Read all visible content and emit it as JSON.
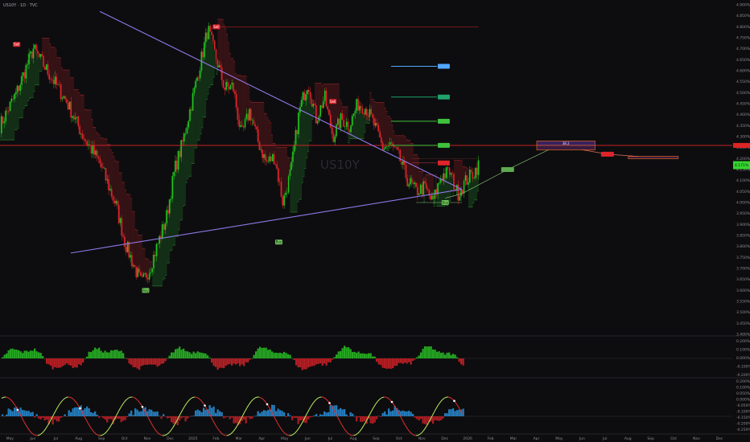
{
  "header": {
    "symbol": "US10Y · 1D · TVC"
  },
  "watermark": "US10Y",
  "colors": {
    "up": "#22c51d",
    "down": "#e0242b",
    "trend": "#9077e8",
    "resistance": "#e02424",
    "bg": "#0d0d0f"
  },
  "chart_data": {
    "type": "candlestick",
    "yticks": [
      "4.900%",
      "4.850%",
      "4.800%",
      "4.750%",
      "4.700%",
      "4.650%",
      "4.600%",
      "4.550%",
      "4.500%",
      "4.450%",
      "4.400%",
      "4.350%",
      "4.300%",
      "4.250%",
      "4.200%",
      "4.150%",
      "4.100%",
      "4.050%",
      "4.000%",
      "3.950%",
      "3.900%",
      "3.850%",
      "3.800%",
      "3.750%",
      "3.700%",
      "3.650%",
      "3.600%",
      "3.550%",
      "3.500%",
      "3.450%",
      "3.400%"
    ],
    "ylim": [
      3.4,
      4.9
    ],
    "xticks": [
      "May",
      "Jun",
      "Jul",
      "Aug",
      "Sep",
      "Oct",
      "Nov",
      "Dec",
      "2025",
      "Feb",
      "Mar",
      "Apr",
      "May",
      "Jun",
      "Jul",
      "Aug",
      "Sep",
      "Oct",
      "Nov",
      "Dec",
      "2026",
      "Feb",
      "Mar",
      "Apr",
      "May",
      "Jun",
      "Jul",
      "Aug",
      "Sep",
      "Oct",
      "Nov",
      "Dec"
    ],
    "price_path": [
      [
        0,
        4.35
      ],
      [
        2,
        4.5
      ],
      [
        4,
        4.7
      ],
      [
        6,
        4.58
      ],
      [
        8,
        4.46
      ],
      [
        10,
        4.3
      ],
      [
        12,
        4.18
      ],
      [
        14,
        3.98
      ],
      [
        15,
        3.82
      ],
      [
        16,
        3.72
      ],
      [
        17,
        3.63
      ],
      [
        18,
        3.7
      ],
      [
        20,
        3.93
      ],
      [
        21,
        4.15
      ],
      [
        22,
        4.28
      ],
      [
        23,
        4.45
      ],
      [
        24,
        4.62
      ],
      [
        25,
        4.79
      ],
      [
        26,
        4.65
      ],
      [
        27,
        4.52
      ],
      [
        28,
        4.53
      ],
      [
        29,
        4.3
      ],
      [
        30,
        4.42
      ],
      [
        31,
        4.28
      ],
      [
        32,
        4.18
      ],
      [
        33,
        4.21
      ],
      [
        34,
        4.0
      ],
      [
        35,
        4.15
      ],
      [
        36,
        4.42
      ],
      [
        37,
        4.55
      ],
      [
        38,
        4.38
      ],
      [
        39,
        4.48
      ],
      [
        40,
        4.3
      ],
      [
        41,
        4.38
      ],
      [
        42,
        4.35
      ],
      [
        43,
        4.45
      ],
      [
        44,
        4.43
      ],
      [
        45,
        4.35
      ],
      [
        46,
        4.25
      ],
      [
        47,
        4.26
      ],
      [
        48,
        4.2
      ],
      [
        49,
        4.1
      ],
      [
        50,
        4.05
      ],
      [
        51,
        4.07
      ],
      [
        52,
        4.0
      ],
      [
        53,
        4.12
      ],
      [
        54,
        4.14
      ],
      [
        55,
        4.04
      ],
      [
        56,
        4.1
      ],
      [
        57,
        4.14
      ],
      [
        57.5,
        4.17
      ]
    ],
    "resistance_level": 4.26,
    "top_line_level": 4.8,
    "trendlines": [
      {
        "from": [
          12,
          4.87
        ],
        "to": [
          55.5,
          4.06
        ]
      },
      {
        "from": [
          8.5,
          3.77
        ],
        "to": [
          55.5,
          4.06
        ]
      }
    ],
    "price_tags": [
      {
        "text": "",
        "value": 4.62,
        "color": "#52a7ff"
      },
      {
        "text": "",
        "value": 4.48,
        "color": "#1fa26b"
      },
      {
        "text": "",
        "value": 4.37,
        "color": "#3fc13c"
      },
      {
        "text": "",
        "value": 4.26,
        "color": "#3fc13c"
      },
      {
        "text": "",
        "value": 4.18,
        "color": "#e0242b"
      }
    ],
    "signals": [
      {
        "type": "sell",
        "text": "Sell",
        "x": 2.0,
        "value": 4.72
      },
      {
        "type": "sell",
        "text": "Sell",
        "x": 26.0,
        "value": 4.8
      },
      {
        "type": "sell",
        "text": "Sell",
        "x": 40.0,
        "value": 4.46
      },
      {
        "type": "buy",
        "text": "Buy",
        "x": 17.5,
        "value": 3.6
      },
      {
        "type": "buy",
        "text": "Buy",
        "x": 33.5,
        "value": 3.82
      },
      {
        "type": "buy",
        "text": "Buy",
        "x": 53.5,
        "value": 4.0
      }
    ],
    "projection": {
      "path": [
        [
          53.5,
          4.02
        ],
        [
          55.5,
          4.04
        ],
        [
          61,
          4.15
        ],
        [
          67,
          4.26
        ],
        [
          73,
          4.22
        ],
        [
          80,
          4.2
        ]
      ],
      "labels": [
        {
          "text": "",
          "at": [
            61,
            4.15
          ],
          "color": "#5eaa52"
        },
        {
          "text": "",
          "at": [
            73,
            4.22
          ],
          "color": "#e0242b"
        }
      ],
      "box_top": {
        "text": "38.2",
        "from": [
          64.5,
          4.28
        ],
        "to": [
          71.5,
          4.26
        ]
      },
      "box_bottom": {
        "from": [
          64.5,
          4.26
        ],
        "to": [
          71.5,
          4.24
        ]
      },
      "box_right": {
        "from": [
          75.5,
          4.21
        ],
        "to": [
          81.5,
          4.2
        ]
      }
    },
    "current": {
      "text": "4.171%",
      "value": 4.17
    },
    "oscillator1": {
      "yticks": [
        "0.200%",
        "0.100%",
        "0.000%",
        "-0.100%",
        "-0.200%"
      ]
    },
    "oscillator2": {
      "yticks": [
        "0.200%",
        "0.100%",
        "0.050%",
        "0.000%",
        "-0.050%",
        "-0.100%",
        "-0.150%",
        "-0.200%",
        "-0.250%"
      ]
    }
  }
}
